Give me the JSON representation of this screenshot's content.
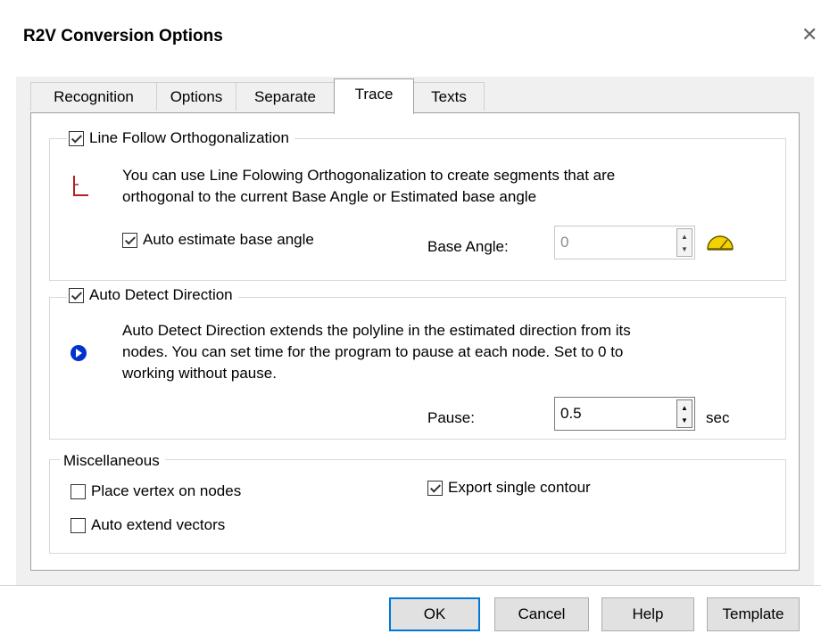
{
  "window": {
    "title": "R2V Conversion Options"
  },
  "tabs": [
    {
      "label": "Recognition",
      "active": false
    },
    {
      "label": "Options",
      "active": false
    },
    {
      "label": "Separate",
      "active": false
    },
    {
      "label": "Trace",
      "active": true
    },
    {
      "label": "Texts",
      "active": false
    }
  ],
  "line_follow": {
    "checkbox_label": "Line Follow Orthogonalization",
    "checked": true,
    "description_line1": "You can use Line Folowing Orthogonalization to create segments that are",
    "description_line2": "orthogonal to the current Base Angle or Estimated base angle",
    "auto_estimate_label": "Auto estimate base angle",
    "auto_estimate_checked": true,
    "base_angle_label": "Base Angle:",
    "base_angle_value": "0",
    "icon": "orthogonal-angle-icon",
    "protractor_icon": "protractor-icon"
  },
  "auto_detect": {
    "checkbox_label": "Auto Detect Direction",
    "checked": true,
    "description_line1": "Auto Detect Direction extends the polyline in the estimated direction from its",
    "description_line2": "nodes. You can set time for the program to pause at each node. Set to 0 to",
    "description_line3": "working without pause.",
    "pause_label": "Pause:",
    "pause_value": "0.5",
    "pause_unit": "sec",
    "icon": "direction-arrow-icon"
  },
  "misc": {
    "legend": "Miscellaneous",
    "place_vertex_label": "Place vertex on nodes",
    "place_vertex_checked": false,
    "auto_extend_label": "Auto extend vectors",
    "auto_extend_checked": false,
    "export_single_label": "Export single contour",
    "export_single_checked": true
  },
  "buttons": {
    "ok": "OK",
    "cancel": "Cancel",
    "help": "Help",
    "template": "Template"
  },
  "colors": {
    "accent": "#0078d7",
    "ortho_icon": "#b22222",
    "direction_icon": "#0033cc",
    "protractor": "#f2d200"
  }
}
